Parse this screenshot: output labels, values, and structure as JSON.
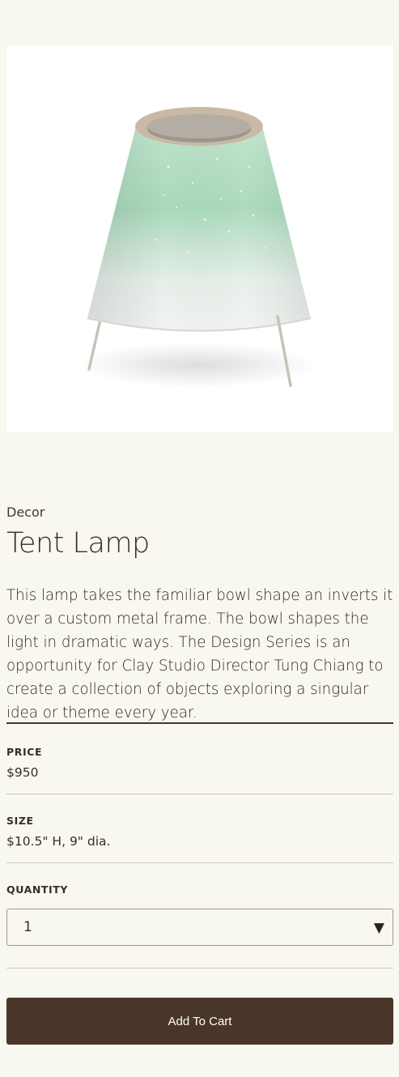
{
  "product": {
    "image_alt": "Tent Lamp product photo",
    "category": "Decor",
    "title": "Tent Lamp",
    "description": "This lamp takes the familiar bowl shape an inverts it over a custom metal frame. The bowl shapes the light in dramatic ways. The Design Series is an opportunity for Clay Studio Director Tung Chiang to create a collection of objects exploring a singular idea or theme every year."
  },
  "details": {
    "price_label": "PRICE",
    "price_value": "$950",
    "size_label": "SIZE",
    "size_value": "$10.5\" H, 9\" dia.",
    "quantity_label": "QUANTITY",
    "quantity_value": "1"
  },
  "actions": {
    "add_to_cart_label": "Add To Cart"
  },
  "colors": {
    "background": "#f8f7f0",
    "accent_brown": "#4a3628",
    "glaze_green": "#a8d8b8"
  },
  "icons": {
    "dropdown": "caret-down-icon"
  }
}
